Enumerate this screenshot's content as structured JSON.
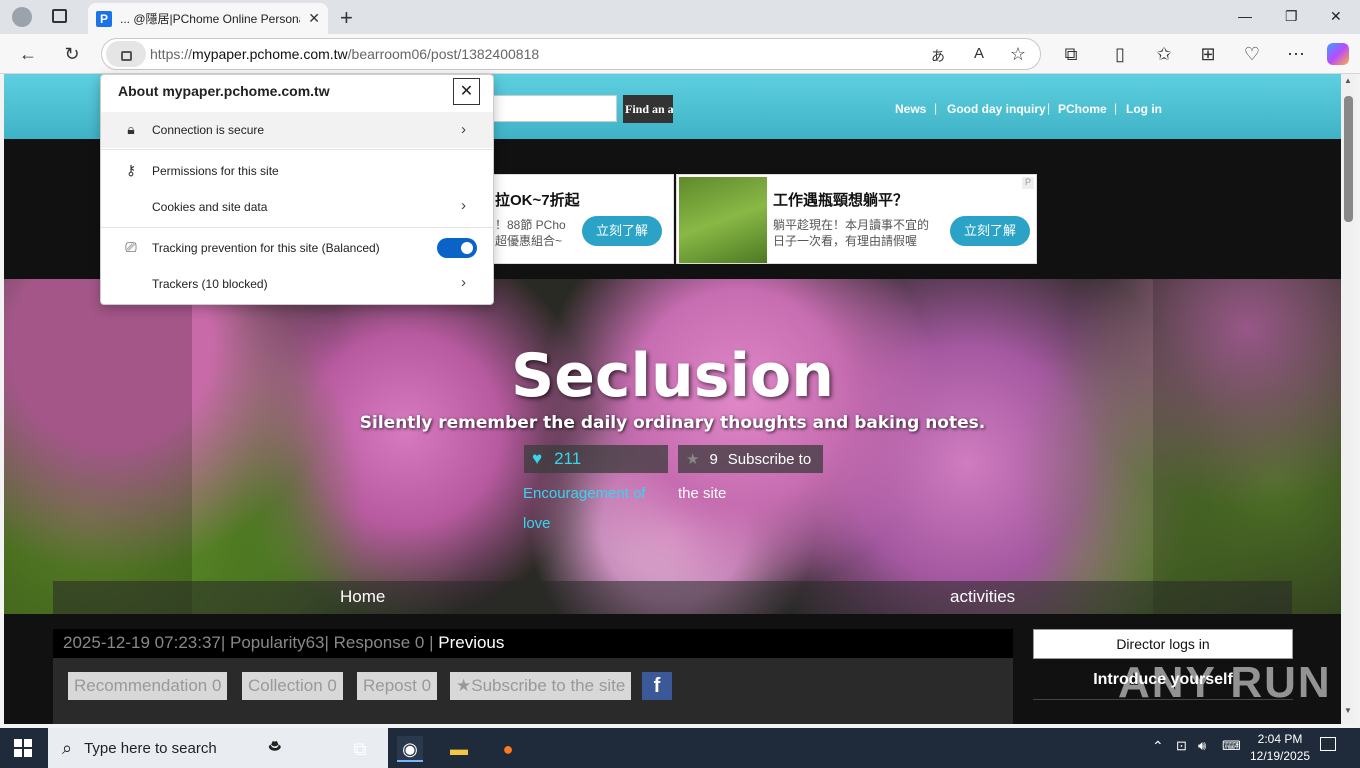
{
  "browser": {
    "tab_title": "... @隱居|PChome Online Personal",
    "tab_favicon": "P",
    "url_prefix": "https://",
    "url_host": "mypaper.pchome.com.tw",
    "url_path": "/bearroom06/post/1382400818"
  },
  "popup": {
    "title": "About mypaper.pchome.com.tw",
    "connection": "Connection is secure",
    "permissions": "Permissions for this site",
    "cookies": "Cookies and site data",
    "tracking": "Tracking prevention for this site (Balanced)",
    "trackers": "Trackers (10 blocked)",
    "tracking_enabled": true
  },
  "site": {
    "find_button": "Find an a",
    "links": [
      "News",
      "Good day inquiry",
      "PChome",
      "Log in"
    ],
    "title": "Seclusion",
    "subtitle": "Silently remember the daily ordinary thoughts and baking notes.",
    "likes": "211",
    "like_label": "Encouragement of love",
    "subscribers": "9",
    "subscribe_label": "Subscribe to",
    "subscribe_label2": "the site",
    "menu": [
      "Home",
      "activities"
    ]
  },
  "ads": [
    {
      "title": "拉OK~7折起",
      "text1": "！88節 PCho",
      "text2": "超優惠組合~",
      "button": "立刻了解"
    },
    {
      "title": "工作遇瓶頸想躺平？",
      "text1": "躺平趁現在！本月讀事不宜的",
      "text2": "日子一次看，有理由請假喔",
      "button": "立刻了解"
    }
  ],
  "post": {
    "meta": "2025-12-19 07:23:37| Popularity63| Response 0 | ",
    "previous": "Previous",
    "recommendation": "Recommendation  0",
    "collection": "Collection  0",
    "repost": "Repost  0",
    "subscribe": "★Subscribe to the site",
    "facebook": "f"
  },
  "sidebar": {
    "director": "Director logs in",
    "introduce": "Introduce yourself"
  },
  "taskbar": {
    "search_placeholder": "Type here to search",
    "time": "2:04 PM",
    "date": "12/19/2025"
  },
  "watermark": "ANY RUN",
  "colors": {
    "header_teal": "#4bc2d3",
    "accent_cyan": "#35d6ef",
    "toggle_blue": "#0a64c8",
    "facebook_blue": "#3b5998"
  }
}
